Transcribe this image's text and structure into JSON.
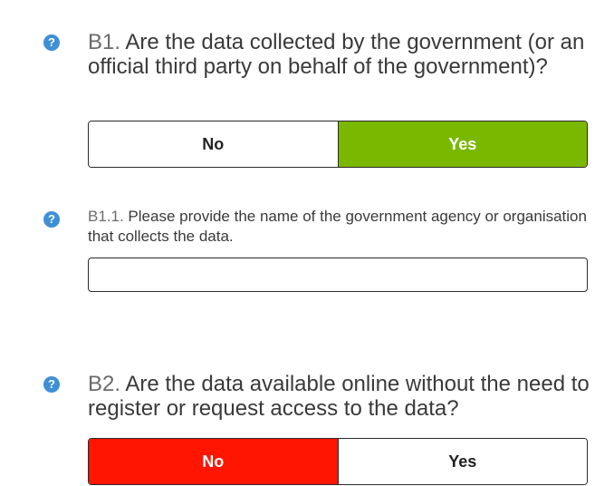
{
  "q_b1": {
    "code": "B1.",
    "text": " Are the data collected by the government (or an official third party on behalf of the government)?",
    "help_icon": "?",
    "options": {
      "no": "No",
      "yes": "Yes"
    },
    "selected": "Yes"
  },
  "q_b1_1": {
    "code": "B1.1.",
    "text": " Please provide the name of the government agency or organisation that collects the data.",
    "help_icon": "?",
    "value": "",
    "placeholder": ""
  },
  "q_b2": {
    "code": "B2.",
    "text": " Are the data available online without the need to register or request access to the data?",
    "help_icon": "?",
    "options": {
      "no": "No",
      "yes": "Yes"
    },
    "selected": "No"
  },
  "colors": {
    "yes_selected": "#7ab800",
    "no_selected": "#ff1500",
    "help_icon": "#3f8fd6"
  },
  "icons": {
    "help": "question-circle-icon"
  }
}
